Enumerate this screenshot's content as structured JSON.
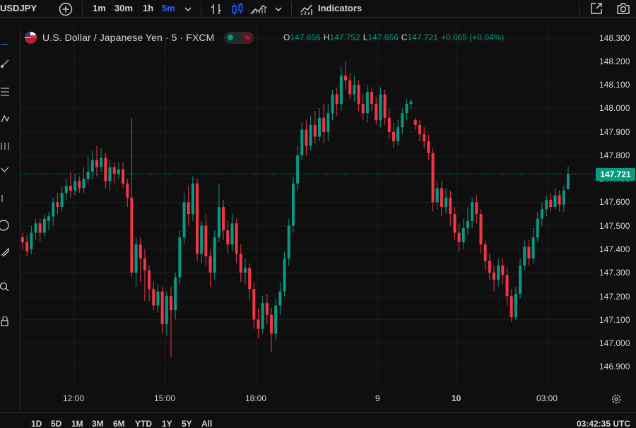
{
  "toolbar": {
    "symbol": "USDJPY",
    "intervals": [
      "1m",
      "30m",
      "1h",
      "5m"
    ],
    "active_interval": "5m",
    "indicators_label": "Indicators"
  },
  "legend": {
    "title": "U.S. Dollar / Japanese Yen · 5 · FXCM",
    "o_label": "O",
    "o_value": "147.656",
    "h_label": "H",
    "h_value": "147.752",
    "l_label": "L",
    "l_value": "147.656",
    "c_label": "C",
    "c_value": "147.721",
    "change": "+0.065 (+0.04%)"
  },
  "price_axis": {
    "ticks": [
      "148.300",
      "148.200",
      "148.100",
      "148.000",
      "147.900",
      "147.800",
      "147.700",
      "147.600",
      "147.500",
      "147.400",
      "147.300",
      "147.200",
      "147.100",
      "147.000",
      "146.900"
    ],
    "last_price": "147.721"
  },
  "time_axis": {
    "labels": [
      "12:00",
      "15:00",
      "18:00",
      "9",
      "10",
      "03:00"
    ],
    "bold_labels": [
      "10"
    ]
  },
  "bottom": {
    "ranges": [
      "1D",
      "5D",
      "1M",
      "3M",
      "6M",
      "YTD",
      "1Y",
      "5Y",
      "All"
    ],
    "clock": "03:42:35 UTC"
  },
  "colors": {
    "up": "#089981",
    "down": "#f23645",
    "background": "#0f0f0f",
    "active": "#2962ff"
  },
  "chart_data": {
    "type": "candlestick",
    "symbol": "USDJPY",
    "ylim": [
      146.85,
      148.32
    ],
    "last_price": 147.721,
    "candles": [
      [
        147.45,
        147.43,
        147.47,
        147.4
      ],
      [
        147.43,
        147.39,
        147.46,
        147.37
      ],
      [
        147.4,
        147.47,
        147.5,
        147.38
      ],
      [
        147.47,
        147.51,
        147.53,
        147.44
      ],
      [
        147.51,
        147.47,
        147.53,
        147.43
      ],
      [
        147.47,
        147.53,
        147.55,
        147.45
      ],
      [
        147.52,
        147.54,
        147.56,
        147.48
      ],
      [
        147.54,
        147.6,
        147.62,
        147.5
      ],
      [
        147.6,
        147.58,
        147.64,
        147.55
      ],
      [
        147.58,
        147.64,
        147.67,
        147.56
      ],
      [
        147.64,
        147.67,
        147.7,
        147.61
      ],
      [
        147.67,
        147.65,
        147.73,
        147.62
      ],
      [
        147.65,
        147.69,
        147.72,
        147.63
      ],
      [
        147.69,
        147.66,
        147.71,
        147.64
      ],
      [
        147.66,
        147.7,
        147.75,
        147.64
      ],
      [
        147.7,
        147.73,
        147.8,
        147.68
      ],
      [
        147.73,
        147.78,
        147.82,
        147.7
      ],
      [
        147.78,
        147.75,
        147.84,
        147.71
      ],
      [
        147.75,
        147.79,
        147.83,
        147.73
      ],
      [
        147.79,
        147.69,
        147.81,
        147.66
      ],
      [
        147.69,
        147.75,
        147.78,
        147.65
      ],
      [
        147.75,
        147.72,
        147.77,
        147.68
      ],
      [
        147.72,
        147.74,
        147.77,
        147.7
      ],
      [
        147.74,
        147.68,
        147.77,
        147.66
      ],
      [
        147.68,
        147.62,
        147.7,
        147.58
      ],
      [
        147.62,
        147.3,
        147.96,
        147.28
      ],
      [
        147.3,
        147.42,
        147.45,
        147.24
      ],
      [
        147.42,
        147.36,
        147.45,
        147.26
      ],
      [
        147.36,
        147.31,
        147.4,
        147.18
      ],
      [
        147.31,
        147.23,
        147.33,
        147.18
      ],
      [
        147.23,
        147.16,
        147.26,
        147.14
      ],
      [
        147.16,
        147.22,
        147.25,
        147.13
      ],
      [
        147.22,
        147.08,
        147.24,
        147.04
      ],
      [
        147.08,
        147.2,
        147.22,
        147.03
      ],
      [
        147.2,
        147.14,
        147.24,
        146.94
      ],
      [
        147.14,
        147.28,
        147.3,
        147.1
      ],
      [
        147.28,
        147.45,
        147.48,
        147.25
      ],
      [
        147.45,
        147.6,
        147.64,
        147.42
      ],
      [
        147.6,
        147.55,
        147.67,
        147.5
      ],
      [
        147.55,
        147.68,
        147.71,
        147.52
      ],
      [
        147.68,
        147.38,
        147.7,
        147.35
      ],
      [
        147.38,
        147.5,
        147.52,
        147.34
      ],
      [
        147.5,
        147.37,
        147.55,
        147.33
      ],
      [
        147.37,
        147.3,
        147.4,
        147.24
      ],
      [
        147.3,
        147.45,
        147.48,
        147.27
      ],
      [
        147.45,
        147.58,
        147.68,
        147.43
      ],
      [
        147.58,
        147.48,
        147.61,
        147.44
      ],
      [
        147.48,
        147.42,
        147.52,
        147.38
      ],
      [
        147.42,
        147.51,
        147.55,
        147.39
      ],
      [
        147.51,
        147.38,
        147.53,
        147.34
      ],
      [
        147.38,
        147.3,
        147.42,
        147.26
      ],
      [
        147.3,
        147.32,
        147.36,
        147.25
      ],
      [
        147.32,
        147.23,
        147.34,
        147.18
      ],
      [
        147.23,
        147.1,
        147.26,
        147.06
      ],
      [
        147.1,
        147.06,
        147.15,
        147.02
      ],
      [
        147.06,
        147.17,
        147.2,
        147.04
      ],
      [
        147.17,
        147.12,
        147.21,
        147.08
      ],
      [
        147.12,
        147.04,
        147.15,
        146.96
      ],
      [
        147.04,
        147.16,
        147.19,
        147.01
      ],
      [
        147.16,
        147.22,
        147.26,
        147.12
      ],
      [
        147.22,
        147.36,
        147.39,
        147.2
      ],
      [
        147.36,
        147.5,
        147.53,
        147.33
      ],
      [
        147.5,
        147.68,
        147.71,
        147.47
      ],
      [
        147.68,
        147.8,
        147.84,
        147.65
      ],
      [
        147.8,
        147.91,
        147.94,
        147.78
      ],
      [
        147.91,
        147.84,
        147.95,
        147.8
      ],
      [
        147.84,
        147.93,
        147.97,
        147.82
      ],
      [
        147.93,
        147.88,
        147.99,
        147.85
      ],
      [
        147.88,
        147.96,
        148.0,
        147.86
      ],
      [
        147.96,
        147.9,
        148.02,
        147.85
      ],
      [
        147.9,
        147.98,
        148.02,
        147.86
      ],
      [
        147.98,
        148.06,
        148.08,
        147.95
      ],
      [
        148.06,
        148.02,
        148.09,
        147.97
      ],
      [
        148.02,
        148.14,
        148.18,
        147.99
      ],
      [
        148.14,
        148.12,
        148.2,
        148.08
      ],
      [
        148.12,
        148.06,
        148.15,
        148.04
      ],
      [
        148.06,
        148.1,
        148.14,
        148.03
      ],
      [
        148.1,
        148.02,
        148.12,
        147.99
      ],
      [
        148.02,
        147.98,
        148.06,
        147.95
      ],
      [
        147.98,
        148.07,
        148.1,
        147.94
      ],
      [
        148.07,
        148.02,
        148.09,
        147.99
      ],
      [
        148.02,
        147.95,
        148.05,
        147.93
      ],
      [
        147.95,
        148.06,
        148.09,
        147.92
      ],
      [
        148.06,
        147.96,
        148.08,
        147.93
      ],
      [
        147.96,
        147.9,
        148.0,
        147.87
      ],
      [
        147.9,
        147.86,
        147.94,
        147.83
      ],
      [
        147.86,
        147.92,
        147.95,
        147.84
      ],
      [
        147.92,
        147.98,
        148.0,
        147.89
      ],
      [
        147.98,
        148.02,
        148.04,
        147.95
      ],
      [
        148.02,
        148.03,
        148.04,
        148.0
      ],
      [
        147.95,
        147.93,
        147.96,
        147.91
      ],
      [
        147.93,
        147.89,
        147.95,
        147.86
      ],
      [
        147.89,
        147.86,
        147.92,
        147.83
      ],
      [
        147.86,
        147.81,
        147.89,
        147.78
      ],
      [
        147.81,
        147.6,
        147.83,
        147.56
      ],
      [
        147.6,
        147.66,
        147.69,
        147.57
      ],
      [
        147.66,
        147.58,
        147.69,
        147.54
      ],
      [
        147.58,
        147.62,
        147.66,
        147.55
      ],
      [
        147.62,
        147.55,
        147.65,
        147.5
      ],
      [
        147.55,
        147.47,
        147.58,
        147.44
      ],
      [
        147.47,
        147.43,
        147.51,
        147.39
      ],
      [
        147.43,
        147.49,
        147.53,
        147.4
      ],
      [
        147.49,
        147.52,
        147.58,
        147.46
      ],
      [
        147.52,
        147.6,
        147.62,
        147.49
      ],
      [
        147.6,
        147.55,
        147.63,
        147.51
      ],
      [
        147.55,
        147.42,
        147.57,
        147.38
      ],
      [
        147.42,
        147.35,
        147.44,
        147.31
      ],
      [
        147.35,
        147.3,
        147.38,
        147.27
      ],
      [
        147.3,
        147.27,
        147.33,
        147.22
      ],
      [
        147.27,
        147.33,
        147.36,
        147.24
      ],
      [
        147.33,
        147.29,
        147.36,
        147.25
      ],
      [
        147.29,
        147.2,
        147.32,
        147.16
      ],
      [
        147.2,
        147.11,
        147.23,
        147.09
      ],
      [
        147.11,
        147.21,
        147.24,
        147.1
      ],
      [
        147.21,
        147.33,
        147.36,
        147.19
      ],
      [
        147.33,
        147.41,
        147.44,
        147.31
      ],
      [
        147.41,
        147.36,
        147.44,
        147.33
      ],
      [
        147.36,
        147.45,
        147.49,
        147.34
      ],
      [
        147.45,
        147.53,
        147.56,
        147.43
      ],
      [
        147.53,
        147.57,
        147.6,
        147.5
      ],
      [
        147.57,
        147.61,
        147.63,
        147.54
      ],
      [
        147.61,
        147.58,
        147.64,
        147.56
      ],
      [
        147.58,
        147.63,
        147.66,
        147.57
      ],
      [
        147.63,
        147.59,
        147.65,
        147.56
      ],
      [
        147.59,
        147.65,
        147.67,
        147.56
      ],
      [
        147.656,
        147.721,
        147.752,
        147.656
      ]
    ]
  }
}
